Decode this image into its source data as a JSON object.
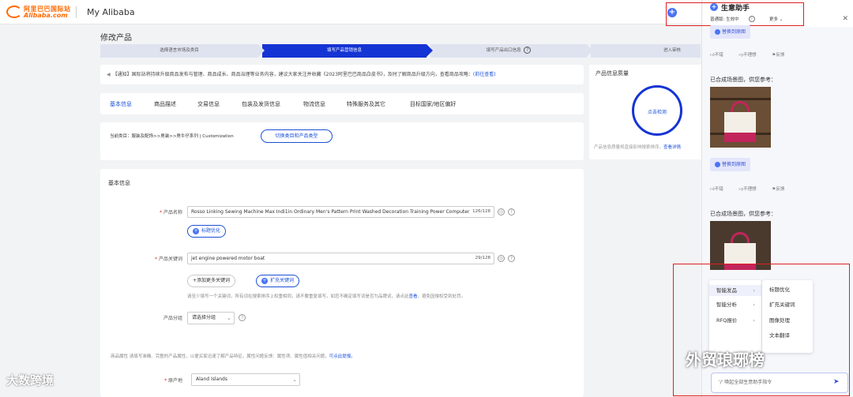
{
  "topbar": {
    "logo_cn": "阿里巴巴国际站",
    "logo_en": "Alibaba.com",
    "site_title": "My Alibaba"
  },
  "page": {
    "title": "修改产品"
  },
  "steps": [
    {
      "label": "选择语言市场及类目"
    },
    {
      "label": "填写产品营销信息"
    },
    {
      "label": "填写产品出口信息"
    },
    {
      "label": "进入审核"
    }
  ],
  "notice": {
    "text": "【通知】国际站将持续升级商品发布与管理、商品成长、商品治理等业务内容，建议大家关注并收藏《2023阿里巴巴商品白皮书》，及时了解商品升级方向，查看商品攻略：",
    "link": "(前往查看)"
  },
  "tabs": [
    "基本信息",
    "商品描述",
    "交易信息",
    "包装及发货信息",
    "物流信息",
    "特殊服务及其它",
    "目标国家/地区偏好"
  ],
  "category": {
    "text": "当前类目：服装及配饰>>男装>>男牛仔系列 | Customization",
    "switch_button": "切换类目和产品类型"
  },
  "quality": {
    "title": "产品信息质量",
    "check_label": "点击检测",
    "note": "产品信息质量将直接影响搜索排序。",
    "note_link": "查看详情"
  },
  "basic": {
    "heading": "基本信息",
    "name_label": "产品名称",
    "name_value": "Rosso Linking Sewing Machine Max Indi1in Ordinary Men's Pattern Print Washed Decoration Training Power Computer",
    "name_count": "126/128",
    "title_opt_button": "标题优化",
    "keyword_label": "产品关键词",
    "keyword_value": "jet engine powered motor boat",
    "keyword_count": "29/128",
    "add_keyword_button": "+添加更多关键词",
    "expand_keyword_button": "扩充关键词",
    "keyword_hint": "请至少填写一个关键词，所有词在搜索排序上权重相同，请不要重复填写。如您不确定填写词是否为品牌词，请点此",
    "keyword_hint_link": "查看",
    "keyword_hint_tail": "，避免因侵权受到处罚。",
    "group_label": "产品分组",
    "group_placeholder": "请选择分组",
    "attr_note": "商品属性  请填写准确、完整的产品属性，以便买家迅速了解产品特征。属性问题反馈：属性项、属性值相关问题，",
    "attr_link": "可点此提报。",
    "origin_label": "原产地",
    "origin_value": "Aland Islands"
  },
  "assistant": {
    "title": "生意助手",
    "subtitle": "普通版: 生效中",
    "more": "更多",
    "replace_button": "替换到原图",
    "feedback": [
      "不错",
      "不理想",
      "反馈"
    ],
    "scene_label": "已合成场景图，供您参考："
  },
  "menu": {
    "primary": [
      {
        "label": "智能发品"
      },
      {
        "label": "智能分析"
      },
      {
        "label": "RFQ报价"
      }
    ],
    "secondary": [
      "标题优化",
      "扩充关键词",
      "图像处理",
      "文本翻译"
    ]
  },
  "command_input": {
    "placeholder": "'/' 唤起全部生意助手指令"
  },
  "watermarks": {
    "left": "大数跨境",
    "right": "外贸琅琊榜"
  },
  "colors": {
    "brand": "#ff6a00",
    "primary": "#1534d4",
    "highlight_box": "#e02020"
  }
}
